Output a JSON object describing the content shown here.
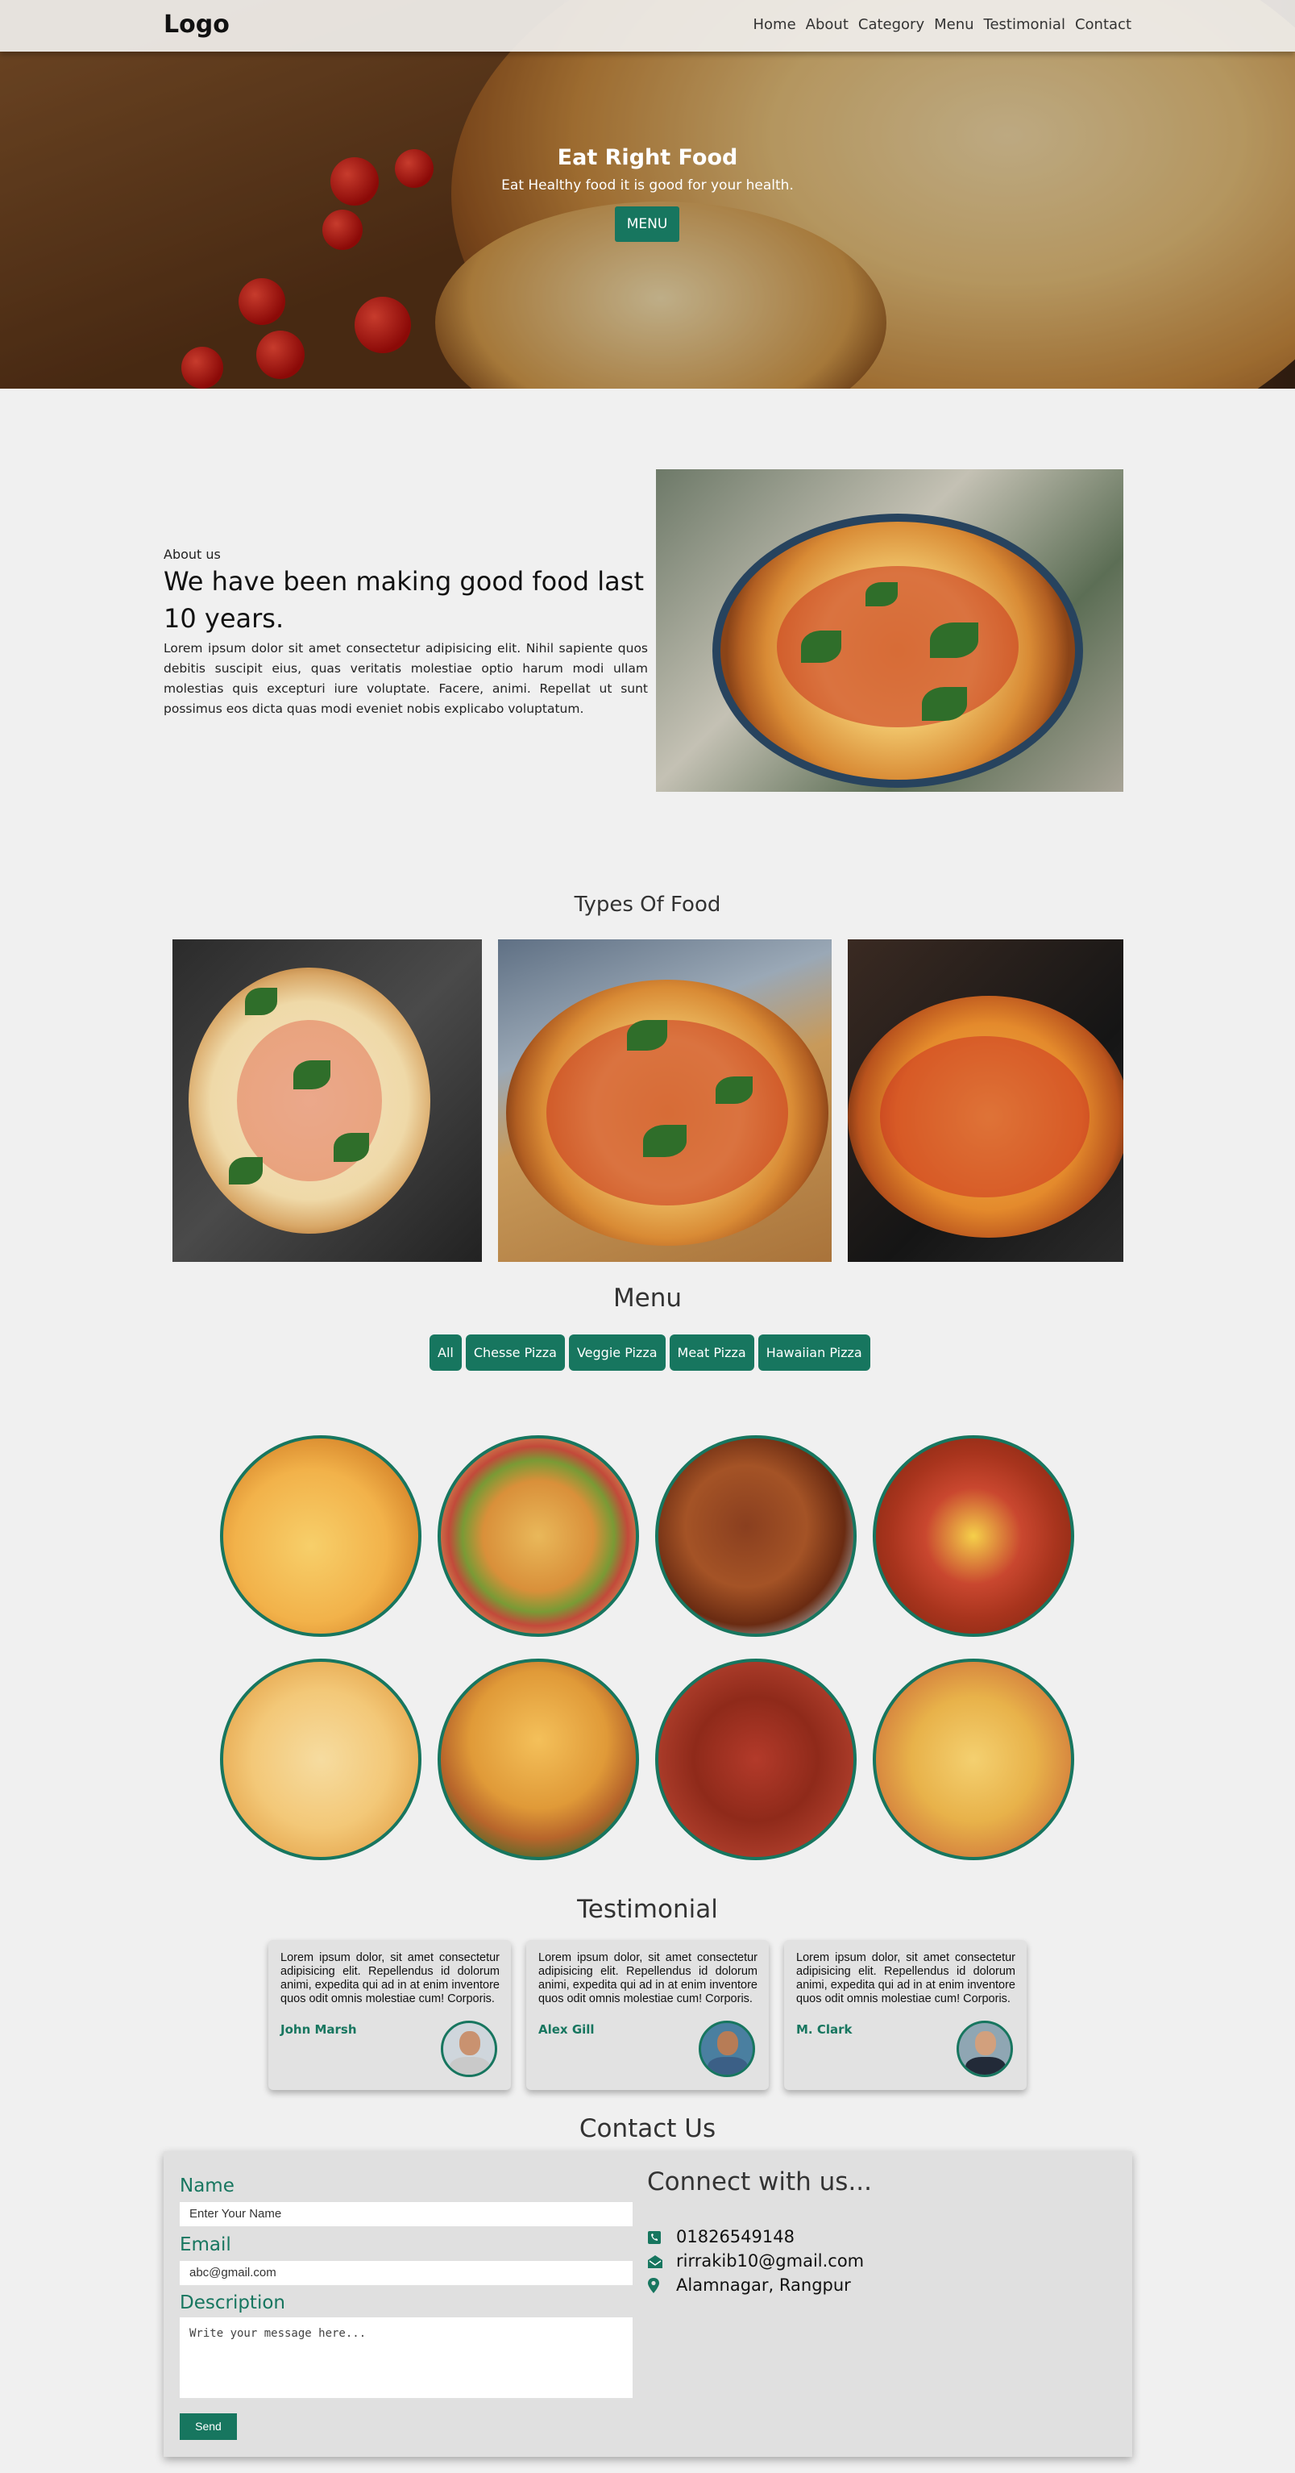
{
  "header": {
    "logo": "Logo",
    "nav": [
      "Home",
      "About",
      "Category",
      "Menu",
      "Testimonial",
      "Contact"
    ]
  },
  "hero": {
    "title": "Eat Right Food",
    "subtitle": "Eat Healthy food it is good for your health.",
    "button": "MENU"
  },
  "about": {
    "small": "About us",
    "heading": "We have been making good food last 10 years.",
    "text": "Lorem ipsum dolor sit amet consectetur adipisicing elit. Nihil sapiente quos debitis suscipit eius, quas veritatis molestiae optio harum modi ullam molestias quis excepturi iure voluptate. Facere, animi. Repellat ut sunt possimus eos dicta quas modi eveniet nobis explicabo voluptatum."
  },
  "types": {
    "title": "Types Of Food"
  },
  "menu": {
    "title": "Menu",
    "filters": [
      "All",
      "Chesse Pizza",
      "Veggie Pizza",
      "Meat Pizza",
      "Hawaiian Pizza"
    ]
  },
  "testimonial": {
    "title": "Testimonial",
    "items": [
      {
        "text": "Lorem ipsum dolor, sit amet consectetur adipisicing elit. Repellendus id dolorum animi, expedita qui ad in at enim inventore quos odit omnis molestiae cum! Corporis.",
        "name": "John Marsh"
      },
      {
        "text": "Lorem ipsum dolor, sit amet consectetur adipisicing elit. Repellendus id dolorum animi, expedita qui ad in at enim inventore quos odit omnis molestiae cum! Corporis.",
        "name": "Alex Gill"
      },
      {
        "text": "Lorem ipsum dolor, sit amet consectetur adipisicing elit. Repellendus id dolorum animi, expedita qui ad in at enim inventore quos odit omnis molestiae cum! Corporis.",
        "name": "M. Clark"
      }
    ]
  },
  "contact": {
    "title": "Contact Us",
    "name_label": "Name",
    "name_placeholder": "Enter Your Name",
    "email_label": "Email",
    "email_placeholder": "abc@gmail.com",
    "desc_label": "Description",
    "desc_placeholder": "Write your message here...",
    "send": "Send",
    "connect_title": "Connect with us...",
    "phone": "01826549148",
    "email": "rirrakib10@gmail.com",
    "address": "Alamnagar, Rangpur"
  },
  "colors": {
    "accent": "#17765f",
    "background": "#f0f0f0",
    "card": "#e2e2e2"
  },
  "icons": [
    "phone-icon",
    "envelope-icon",
    "location-pin-icon"
  ]
}
